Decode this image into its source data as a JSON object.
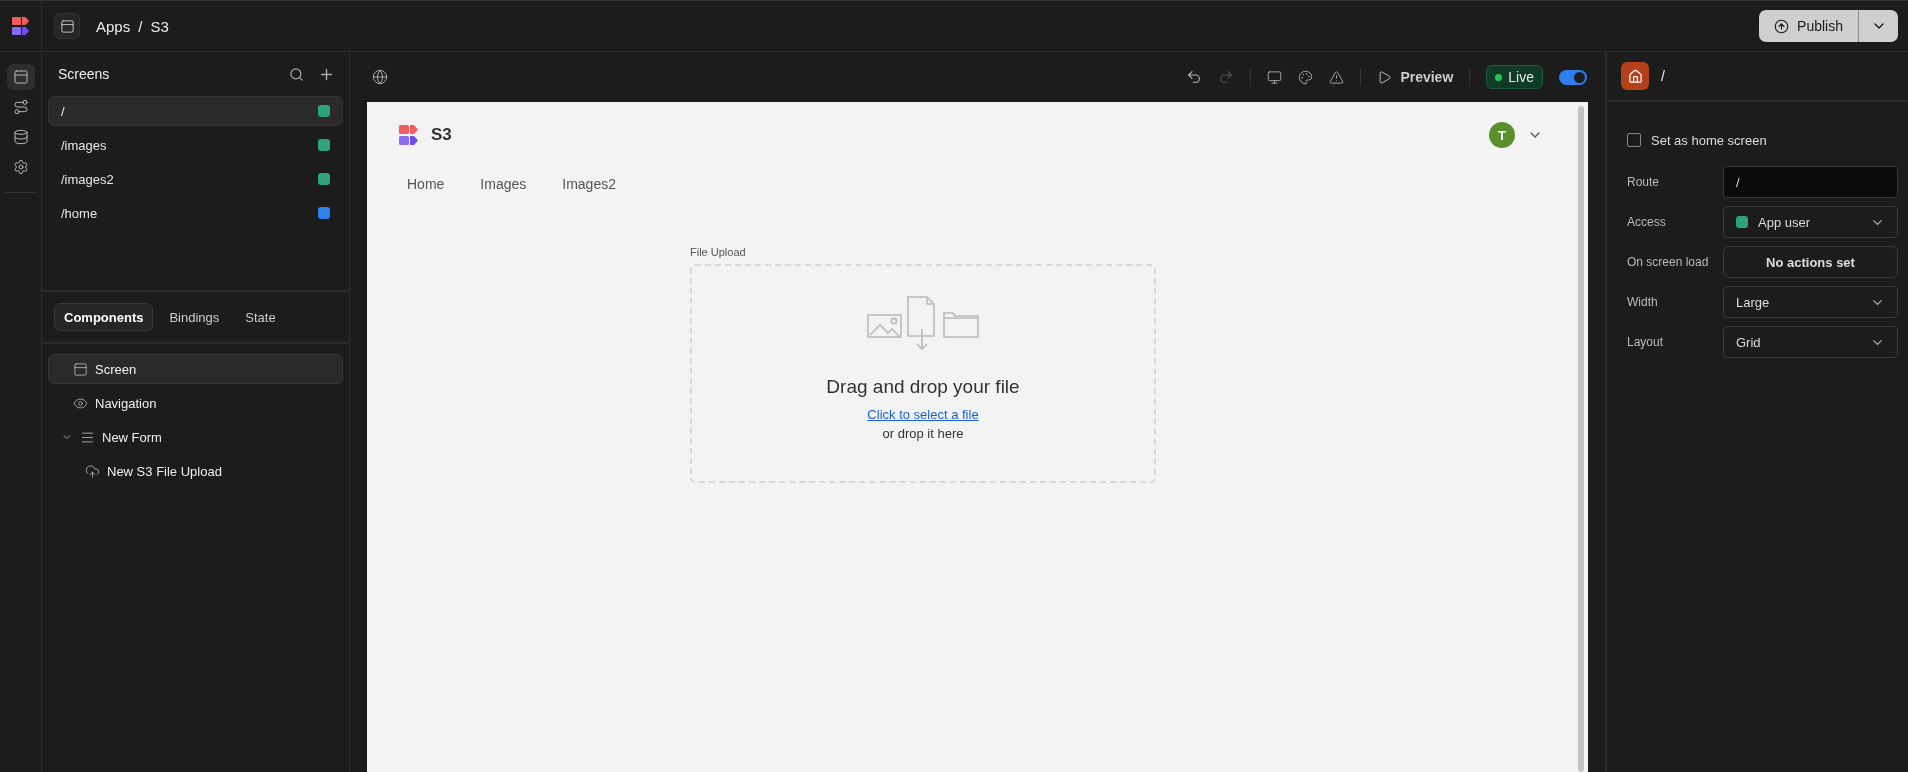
{
  "header": {
    "breadcrumb": [
      "Apps",
      "S3"
    ],
    "separator": "/",
    "publish": {
      "label": "Publish"
    }
  },
  "rail": [
    {
      "kind": "screens",
      "selected": true
    },
    {
      "kind": "automations",
      "selected": false
    },
    {
      "kind": "data",
      "selected": false
    },
    {
      "kind": "settings",
      "selected": false
    }
  ],
  "screens": {
    "title": "Screens",
    "items": [
      {
        "route": "/",
        "selected": true,
        "color": "#2ea37b"
      },
      {
        "route": "/images",
        "selected": false,
        "color": "#2ea37b"
      },
      {
        "route": "/images2",
        "selected": false,
        "color": "#2ea37b"
      },
      {
        "route": "/home",
        "selected": false,
        "color": "#2f80ed"
      }
    ]
  },
  "panel_tabs": [
    {
      "label": "Components",
      "selected": true
    },
    {
      "label": "Bindings",
      "selected": false
    },
    {
      "label": "State",
      "selected": false
    }
  ],
  "components": [
    {
      "label": "Screen",
      "kind": "screen",
      "selected": true
    },
    {
      "label": "Navigation",
      "kind": "navigation",
      "selected": false
    },
    {
      "label": "New Form",
      "kind": "form",
      "selected": false,
      "expanded": true,
      "children": [
        {
          "label": "New S3 File Upload",
          "kind": "upload",
          "selected": false
        }
      ]
    }
  ],
  "toolbar": {
    "history": [
      {
        "kind": "undo",
        "disabled": false
      },
      {
        "kind": "redo",
        "disabled": true
      }
    ],
    "preview": "Preview",
    "live": "Live",
    "live_toggle": {
      "on": true
    }
  },
  "canvas": {
    "app_title": "S3",
    "avatar": "T",
    "nav": [
      "Home",
      "Images",
      "Images2"
    ],
    "file_upload": {
      "label": "File Upload",
      "prompt": "Drag and drop your file",
      "link": "Click to select a file",
      "hint": "or drop it here"
    }
  },
  "properties": {
    "title": "/",
    "home_screen": {
      "label": "Set as home screen",
      "checked": false
    },
    "fields": [
      {
        "label": "Route",
        "kind": "input",
        "value": "/"
      },
      {
        "label": "Access",
        "kind": "select",
        "value": "App user",
        "color": "#2ea37b"
      },
      {
        "label": "On screen load",
        "kind": "button",
        "value": "No actions set"
      },
      {
        "label": "Width",
        "kind": "select",
        "value": "Large"
      },
      {
        "label": "Layout",
        "kind": "select",
        "value": "Grid"
      }
    ]
  }
}
